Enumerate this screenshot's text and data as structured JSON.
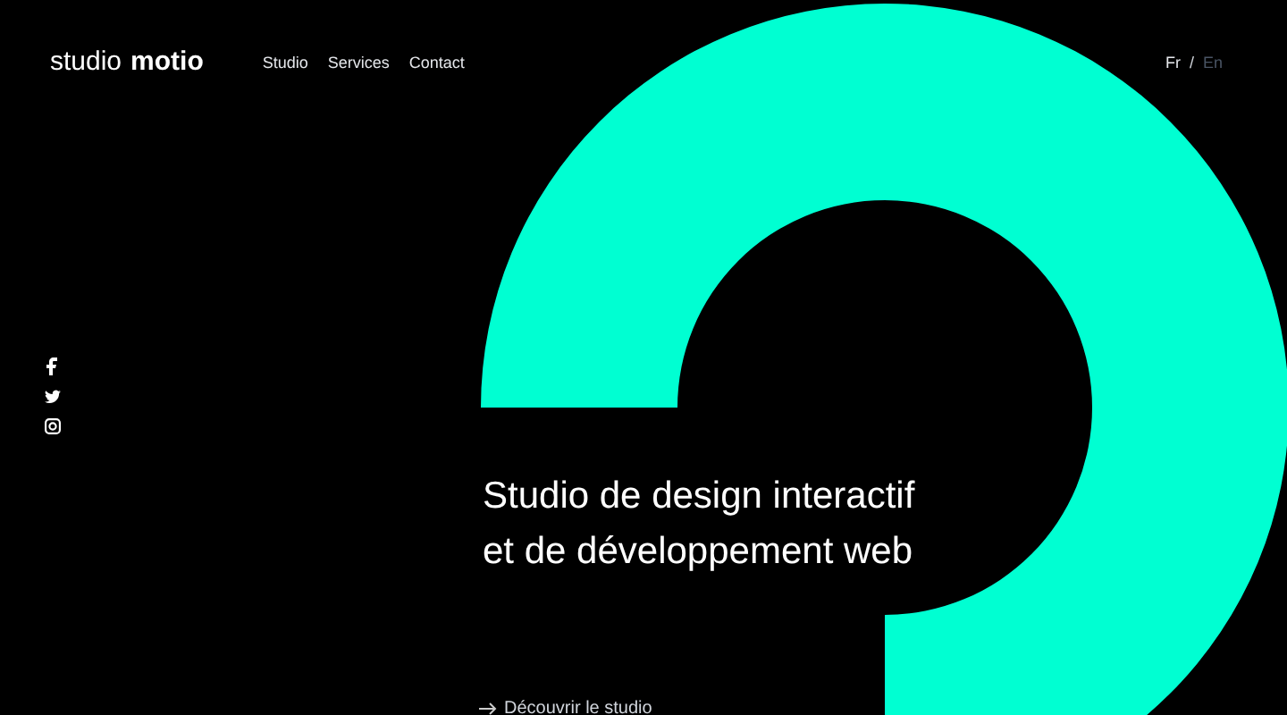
{
  "logo": {
    "light": "studio",
    "bold": "motio"
  },
  "nav": [
    "Studio",
    "Services",
    "Contact"
  ],
  "languages": [
    {
      "label": "Fr",
      "selected": true
    },
    {
      "label": "/",
      "kind": "separator"
    },
    {
      "label": "En",
      "selected": false
    }
  ],
  "hero": {
    "heading_lines": [
      "Studio de design interactif",
      "et de développement web"
    ],
    "link": "Découvrir le studio"
  }
}
